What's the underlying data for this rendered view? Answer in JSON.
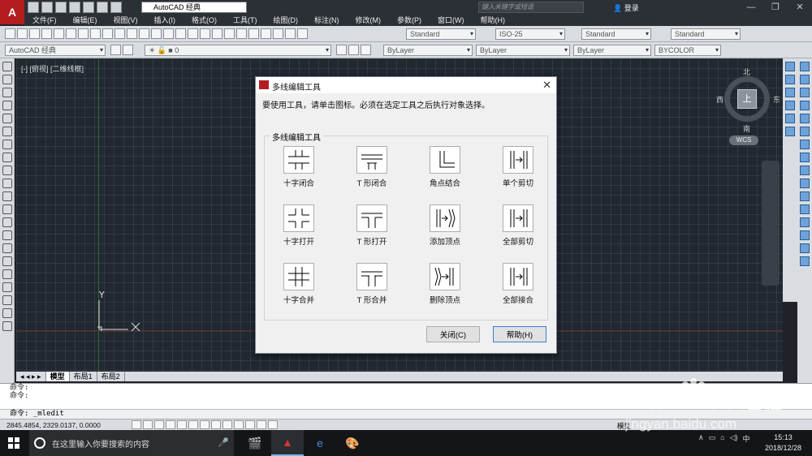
{
  "titlebar": {
    "workspace": "AutoCAD 经典",
    "search_placeholder": "键入关键字或短语",
    "login": "登录"
  },
  "menu": [
    "文件(F)",
    "编辑(E)",
    "视图(V)",
    "插入(I)",
    "格式(O)",
    "工具(T)",
    "绘图(D)",
    "标注(N)",
    "修改(M)",
    "参数(P)",
    "窗口(W)",
    "帮助(H)"
  ],
  "toolbar": {
    "text_style": "Standard",
    "dim_style": "ISO-25",
    "table_style": "Standard",
    "multileader_style": "Standard",
    "workspace": "AutoCAD 经典",
    "layer": "0",
    "color": "ByLayer",
    "linetype": "ByLayer",
    "lineweight": "ByLayer",
    "plotstyle": "BYCOLOR"
  },
  "viewport": {
    "label": "[-] [俯视] [二维线框]",
    "ucs_y": "Y"
  },
  "viewcube": {
    "north": "北",
    "south": "南",
    "east": "东",
    "west": "西",
    "top": "上",
    "wcs": "WCS"
  },
  "tabs": [
    "模型",
    "布局1",
    "布局2"
  ],
  "command": {
    "line1": "命令:",
    "line2": "命令:",
    "current": "命令:  _mledit"
  },
  "status": {
    "coords": "2845.4854, 2329.0137, 0.0000",
    "model": "模型"
  },
  "taskbar": {
    "search": "在这里输入你要搜索的内容",
    "time": "15:13",
    "date": "2018/12/28"
  },
  "dialog": {
    "title": "多线编辑工具",
    "instruction": "要使用工具，请单击图标。必须在选定工具之后执行对象选择。",
    "group_label": "多线编辑工具",
    "tools": [
      {
        "label": "十字闭合",
        "icon": "closed-cross-icon"
      },
      {
        "label": "T 形闭合",
        "icon": "closed-tee-icon"
      },
      {
        "label": "角点结合",
        "icon": "corner-joint-icon"
      },
      {
        "label": "单个剪切",
        "icon": "cut-single-icon"
      },
      {
        "label": "十字打开",
        "icon": "open-cross-icon"
      },
      {
        "label": "T 形打开",
        "icon": "open-tee-icon"
      },
      {
        "label": "添加顶点",
        "icon": "add-vertex-icon"
      },
      {
        "label": "全部剪切",
        "icon": "cut-all-icon"
      },
      {
        "label": "十字合并",
        "icon": "merged-cross-icon"
      },
      {
        "label": "T 形合并",
        "icon": "merged-tee-icon"
      },
      {
        "label": "删除顶点",
        "icon": "delete-vertex-icon"
      },
      {
        "label": "全部接合",
        "icon": "weld-all-icon"
      }
    ],
    "close_button": "关闭(C)",
    "help_button": "帮助(H)"
  },
  "watermark": {
    "brand": "Bai",
    "brand2": "du",
    "cn": "经验",
    "url": "jingyan.baidu.com"
  },
  "colors": {
    "app_red": "#b31d20",
    "canvas": "#212830",
    "toolbar": "#d9dde2"
  }
}
